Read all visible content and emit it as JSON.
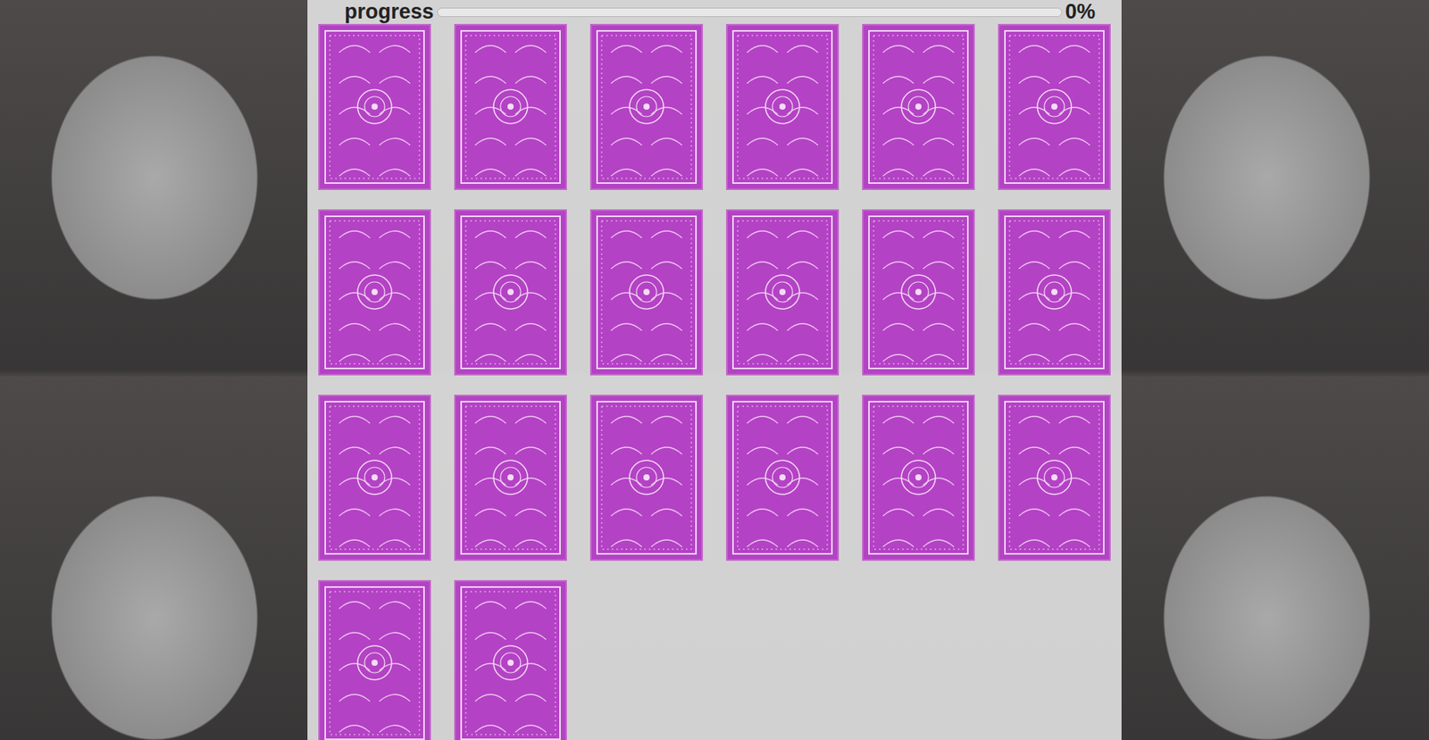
{
  "progress": {
    "label": "progress",
    "level": 0,
    "reading": "0%"
  },
  "cards": [
    {
      "flipped": false
    },
    {
      "flipped": false
    },
    {
      "flipped": false
    },
    {
      "flipped": false
    },
    {
      "flipped": false
    },
    {
      "flipped": false
    },
    {
      "flipped": false
    },
    {
      "flipped": false
    },
    {
      "flipped": false
    },
    {
      "flipped": false
    },
    {
      "flipped": false
    },
    {
      "flipped": false
    },
    {
      "flipped": false
    },
    {
      "flipped": false
    },
    {
      "flipped": false
    },
    {
      "flipped": false
    },
    {
      "flipped": false
    },
    {
      "flipped": false
    },
    {
      "flipped": false
    },
    {
      "flipped": false
    }
  ]
}
